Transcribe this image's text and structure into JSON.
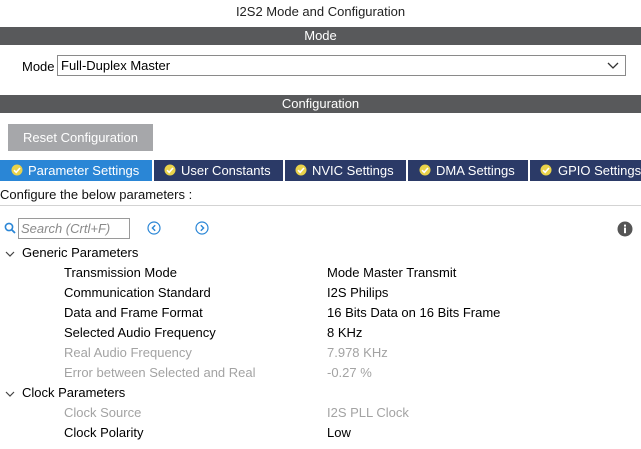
{
  "window": {
    "title": "I2S2 Mode and Configuration"
  },
  "mode_section": {
    "header": "Mode",
    "label": "Mode",
    "selected": "Full-Duplex Master"
  },
  "config_section": {
    "header": "Configuration",
    "reset_label": "Reset Configuration"
  },
  "tabs": [
    {
      "label": "Parameter Settings",
      "active": true
    },
    {
      "label": "User Constants",
      "active": false
    },
    {
      "label": "NVIC Settings",
      "active": false
    },
    {
      "label": "DMA Settings",
      "active": false
    },
    {
      "label": "GPIO Settings",
      "active": false
    }
  ],
  "hint": "Configure the below parameters :",
  "search": {
    "placeholder": "Search (Crtl+F)",
    "value": ""
  },
  "groups": [
    {
      "name": "Generic Parameters",
      "params": [
        {
          "name": "Transmission Mode",
          "value": "Mode Master Transmit",
          "editable": true
        },
        {
          "name": "Communication Standard",
          "value": "I2S Philips",
          "editable": true
        },
        {
          "name": "Data and Frame Format",
          "value": "16 Bits Data on 16 Bits Frame",
          "editable": true
        },
        {
          "name": "Selected Audio Frequency",
          "value": "8 KHz",
          "editable": true
        },
        {
          "name": "Real Audio Frequency",
          "value": "7.978 KHz",
          "editable": false
        },
        {
          "name": "Error between Selected and Real",
          "value": "-0.27 %",
          "editable": false
        }
      ]
    },
    {
      "name": "Clock Parameters",
      "params": [
        {
          "name": "Clock Source",
          "value": "I2S PLL Clock",
          "editable": false
        },
        {
          "name": "Clock Polarity",
          "value": "Low",
          "editable": true
        }
      ]
    }
  ],
  "colors": {
    "section_band": "#58595b",
    "tab_bar": "#2b3a67",
    "tab_active": "#2a86d6",
    "check_icon": "#e9d24a",
    "nav_arrows": "#2a86d6",
    "disabled_text": "#a3a3a3",
    "reset_button": "#a6a7aa"
  },
  "icons": {
    "search": "search-icon",
    "prev": "arrow-left-circle-icon",
    "next": "arrow-right-circle-icon",
    "info": "info-icon",
    "tab_status": "check-circle-icon",
    "dropdown": "chevron-down-icon",
    "group_toggle": "chevron-down-icon"
  }
}
